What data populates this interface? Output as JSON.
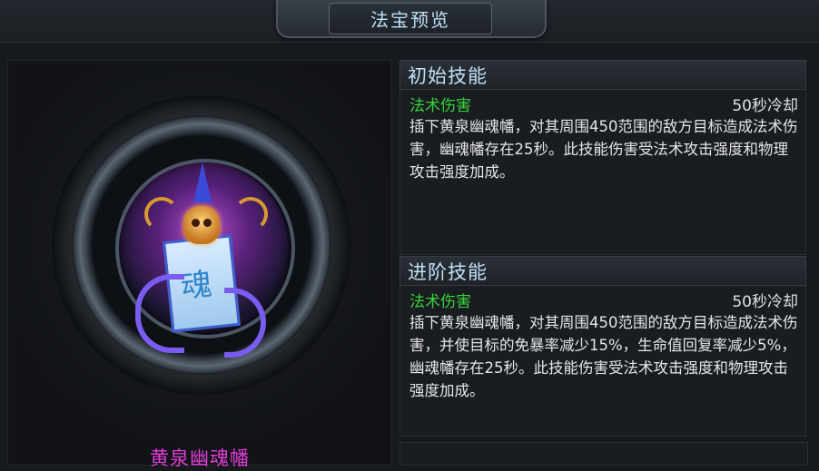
{
  "title": "法宝预览",
  "item": {
    "name": "黄泉幽魂幡",
    "icon": "soul-banner-icon"
  },
  "skills": [
    {
      "header": "初始技能",
      "type": "法术伤害",
      "cooldown": "50秒冷却",
      "description": "插下黄泉幽魂幡，对其周围450范围的敌方目标造成法术伤害，幽魂幡存在25秒。此技能伤害受法术攻击强度和物理攻击强度加成。"
    },
    {
      "header": "进阶技能",
      "type": "法术伤害",
      "cooldown": "50秒冷却",
      "description": "插下黄泉幽魂幡，对其周围450范围的敌方目标造成法术伤害，并使目标的免暴率减少15%，生命值回复率减少5%，幽魂幡存在25秒。此技能伤害受法术攻击强度和物理攻击强度加成。"
    }
  ],
  "colors": {
    "title_text": "#bfe1f5",
    "item_name": "#e23ed8",
    "skill_type": "#39d33c"
  }
}
